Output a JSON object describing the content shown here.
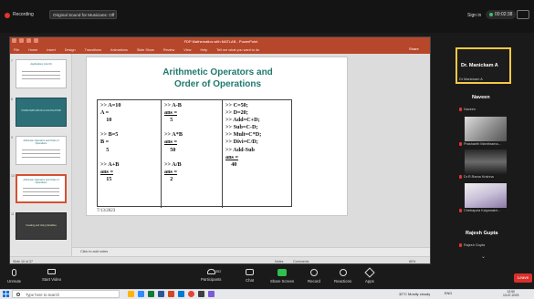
{
  "zoom_top": {
    "recording_label": "Recording",
    "original_sound_button": "Original Sound for Musicians: Off",
    "sign_in": "Sign in",
    "timer": "00:02:38"
  },
  "ppt": {
    "window_title": "FDP Mathematics with MATLAB - PowerPoint",
    "tabs": [
      "File",
      "Home",
      "Insert",
      "Design",
      "Transitions",
      "Animations",
      "Slide Show",
      "Review",
      "View",
      "Help",
      "Tell me what you want to do"
    ],
    "share": "Share",
    "thumbnails": [
      {
        "num": "7",
        "title": "Applications (cont'd)"
      },
      {
        "num": "8",
        "title": "USING MATLAB AS A CALCULATOR"
      },
      {
        "num": "9",
        "title": "Arithmetic Operators and Order of Operations"
      },
      {
        "num": "10",
        "title": "Arithmetic Operators and Order of Operations"
      },
      {
        "num": "11",
        "title": "Creating and Using Variables"
      }
    ],
    "slide": {
      "title_line1": "Arithmetic Operators and",
      "title_line2": "Order of Operations",
      "col1": [
        ">> A=10",
        "A =",
        "    10",
        "",
        ">> B=5",
        "B =",
        "    5",
        "",
        ">> A+B",
        "ans =",
        "    15"
      ],
      "col2": [
        ">> A-B",
        "ans =",
        "    5",
        "",
        ">> A*B",
        "ans =",
        "    50",
        "",
        ">> A/B",
        "ans =",
        "    2"
      ],
      "col3": [
        ">> C=50;",
        ">> D=20;",
        ">> Add=C+D;",
        ">> Sub=C-D;",
        ">> Mult=C*D;",
        ">> Divi=C/D;",
        ">> Add-Sub",
        "ans =",
        "    40"
      ],
      "date": "7/13/2023"
    },
    "notes_placeholder": "Click to add notes",
    "status": {
      "slide_counter": "Slide 10 of 37",
      "notes": "Notes",
      "comments": "Comments",
      "zoom": "80%"
    }
  },
  "participants": {
    "host_name": "Dr. Manickam A",
    "host_label": "Dr Manickam A",
    "people": [
      {
        "heading": "Naveen",
        "label": "Naveen"
      },
      {
        "label": "Prashanth Manthrama..."
      },
      {
        "label": "Dr.R.Rama Krishna"
      },
      {
        "label": "Chebapzia Kalyanakri..."
      },
      {
        "heading": "Rajesh Gupta",
        "label": "Rajesh Gupta"
      }
    ]
  },
  "toolbar": {
    "unmute": "Unmute",
    "start_video": "Start Video",
    "participant_count": "352",
    "participants": "Participants",
    "chat": "Chat",
    "share_screen": "Share Screen",
    "record": "Record",
    "reactions": "Reactions",
    "apps": "Apps",
    "leave": "Leave"
  },
  "taskbar": {
    "search_placeholder": "Type here to search",
    "weather": "32°C  Mostly cloudy",
    "lang": "ENG",
    "time": "13:50",
    "date": "13-07-2023"
  },
  "colors": {
    "accent_ppt": "#b7472a",
    "slide_title": "#1f7a6e",
    "share_green": "#2fbf4e",
    "leave_red": "#d9302b",
    "active_speaker": "#f6c943"
  }
}
